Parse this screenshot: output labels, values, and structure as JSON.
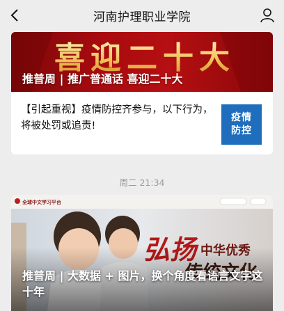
{
  "navbar": {
    "title": "河南护理职业学院",
    "back_icon": "chevron-left-icon",
    "profile_icon": "person-icon"
  },
  "article_group": {
    "cover": {
      "banner_text": "喜迎二十大",
      "caption": "推普周 | 推广普通话  喜迎二十大"
    },
    "sub_item": {
      "text": "【引起重视】疫情防控齐参与，以下行为，将被处罚或追责!",
      "thumb_text": "疫情防控",
      "thumb_color": "#1f6dbd"
    }
  },
  "timestamp": "周二 21:34",
  "article_2": {
    "site_logo_text": "全球中文学习平台",
    "banner_text_1": "弘扬",
    "banner_text_2": "中华优秀",
    "banner_text_3": "传统文化",
    "caption": "推普周 | 大数据 + 图片，换个角度看语言文字这十年"
  },
  "colors": {
    "background": "#ededed",
    "banner_red": "#a90b0f",
    "card": "#ffffff"
  }
}
